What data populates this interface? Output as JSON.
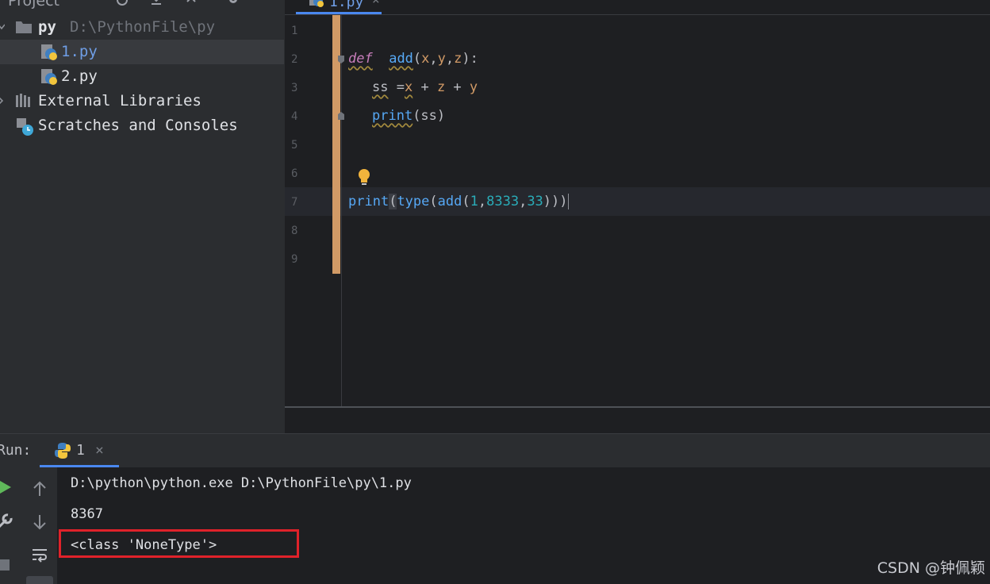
{
  "project_panel": {
    "title": "Project",
    "root": {
      "name": "py",
      "path": "D:\\PythonFile\\py"
    },
    "files": [
      "1.py",
      "2.py"
    ],
    "external_libraries": "External Libraries",
    "scratches": "Scratches and Consoles"
  },
  "editor": {
    "tab_label": "1.py",
    "tab_close": "×",
    "line_numbers": [
      "1",
      "2",
      "3",
      "4",
      "5",
      "6",
      "7",
      "8",
      "9"
    ],
    "code": {
      "line2": {
        "kw": "def",
        "fn": "add",
        "open": "(",
        "p1": "x",
        "c1": ",",
        "p2": "y",
        "c2": ",",
        "p3": "z",
        "close": "):"
      },
      "line3": {
        "var": "ss",
        "eq": " =",
        "a": "x",
        "plus1": " + ",
        "b": "z",
        "plus2": " + ",
        "c": "y"
      },
      "line4": {
        "fn": "print",
        "args": "(ss)"
      },
      "line7": {
        "fn1": "print",
        "o1": "(",
        "fn2": "type",
        "o2": "(",
        "fn3": "add",
        "o3": "(",
        "n1": "1",
        "c1": ",",
        "n2": "8333",
        "c2": ",",
        "n3": "33",
        "close": ")))"
      }
    }
  },
  "run_panel": {
    "title": "Run:",
    "tab_label": "1",
    "tab_close": "×",
    "output": [
      "D:\\python\\python.exe D:\\PythonFile\\py\\1.py",
      "8367",
      "<class 'NoneType'>"
    ]
  },
  "watermark": "CSDN @钟佩颖",
  "colors": {
    "highlight_box": "#e0222a",
    "accent": "#4a88f0",
    "change_marker": "#d19a66"
  }
}
